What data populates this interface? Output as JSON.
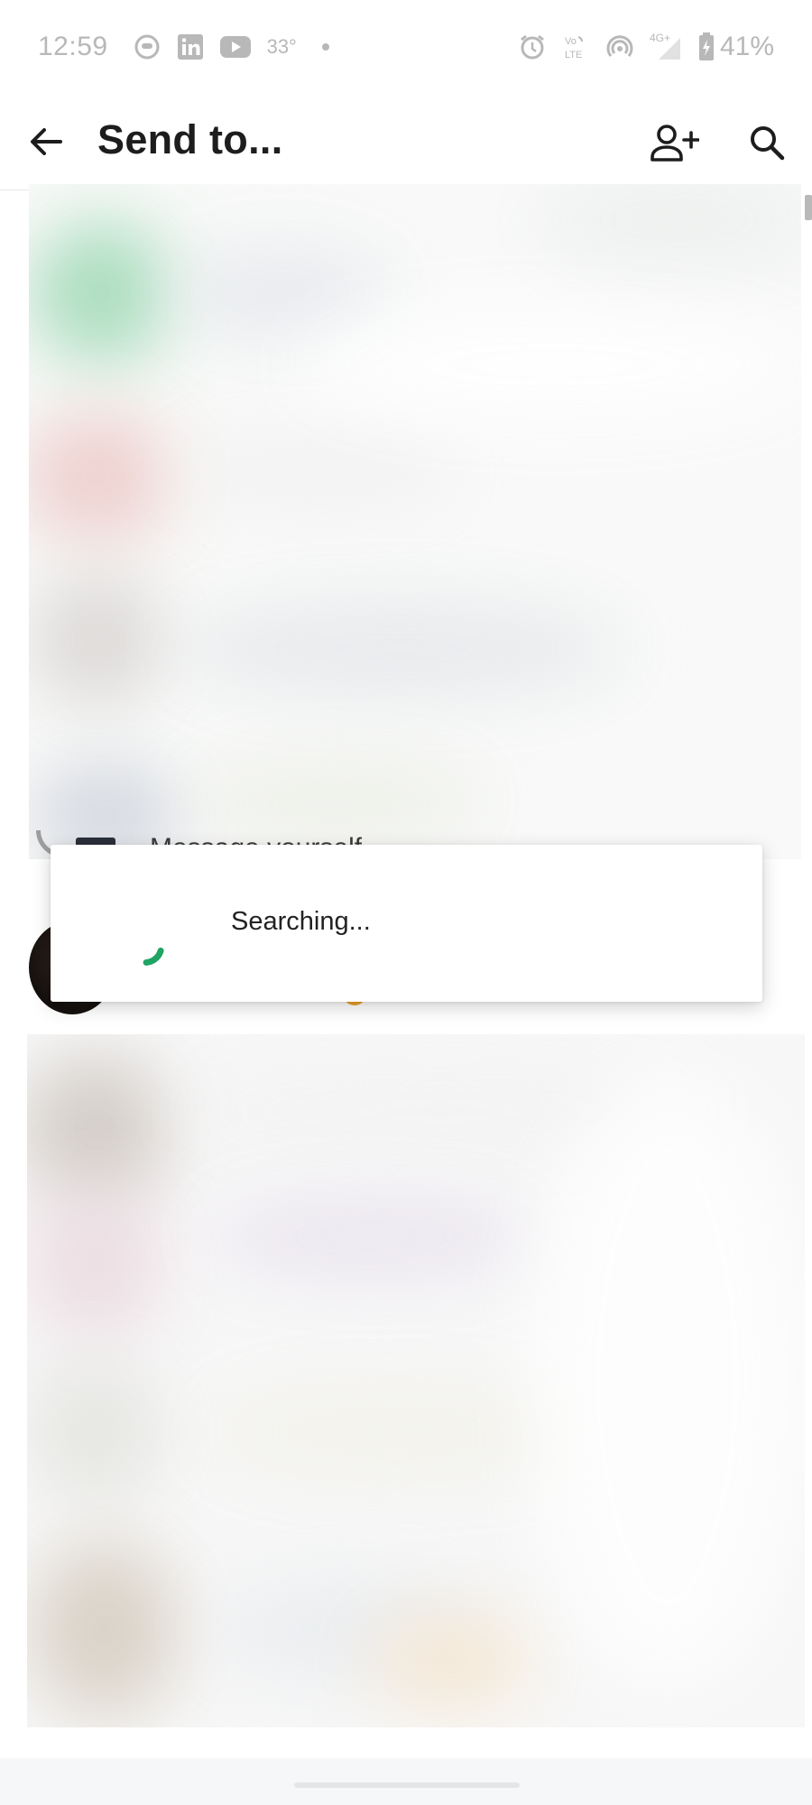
{
  "status_bar": {
    "time": "12:59",
    "temperature": "33°",
    "network": "4G+",
    "volte": "Vo LTE",
    "battery_percent": "41%",
    "icons": [
      "chat-notification-icon",
      "linkedin-icon",
      "youtube-icon",
      "alarm-icon",
      "volte-icon",
      "hotspot-icon",
      "signal-icon",
      "battery-charging-icon"
    ]
  },
  "app_bar": {
    "title": "Send to...",
    "back_icon": "arrow-left-icon",
    "add_contact_icon": "add-person-icon",
    "search_icon": "search-icon"
  },
  "list": {
    "partial_row_label": "Message yourself"
  },
  "dialog": {
    "message": "Searching...",
    "spinner_color": "#1fa463"
  },
  "colors": {
    "accent": "#1fa463",
    "title_text": "#1d1d1d",
    "status_text": "#b8b8b8"
  }
}
